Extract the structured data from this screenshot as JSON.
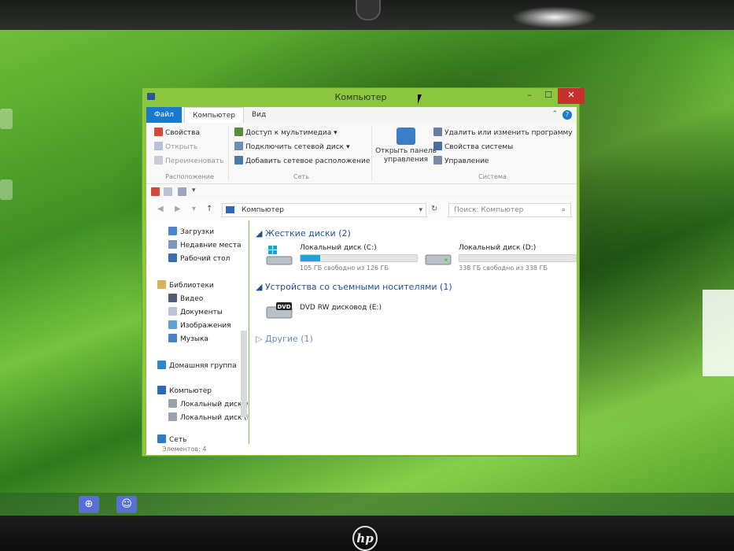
{
  "window": {
    "title": "Компьютер",
    "controls": {
      "minimize": "–",
      "maximize": "☐",
      "close": "✕"
    }
  },
  "ribbon": {
    "tabs": [
      "Файл",
      "Компьютер",
      "Вид"
    ],
    "location": {
      "label": "Расположение",
      "items": [
        "Свойства",
        "Открыть",
        "Переименовать"
      ]
    },
    "network": {
      "label": "Сеть",
      "items": [
        "Доступ к мультимедиа",
        "Подключить сетевой диск",
        "Добавить сетевое расположение"
      ]
    },
    "control_panel": {
      "line1": "Открыть панель",
      "line2": "управления"
    },
    "system": {
      "label": "Система",
      "items": [
        "Удалить или изменить программу",
        "Свойства системы",
        "Управление"
      ]
    }
  },
  "address": {
    "path": "Компьютер",
    "search_placeholder": "Поиск: Компьютер"
  },
  "nav_pane": {
    "items": [
      "Загрузки",
      "Недавние места",
      "Рабочий стол",
      "Библиотеки",
      "Видео",
      "Документы",
      "Изображения",
      "Музыка",
      "Домашняя группа",
      "Компьютер",
      "Локальный диск (C:)",
      "Локальный диск (D:)",
      "Сеть"
    ]
  },
  "content": {
    "hard_drives_header": "Жесткие диски (2)",
    "drives": [
      {
        "name": "Локальный диск (C:)",
        "free": "105 ГБ свободно из 126 ГБ",
        "used_fraction": 0.17
      },
      {
        "name": "Локальный диск (D:)",
        "free": "338 ГБ свободно из 338 ГБ",
        "used_fraction": 0.0
      }
    ],
    "removable_header": "Устройства со съемными носителями (1)",
    "dvd": {
      "name": "DVD RW дисковод (E:)",
      "badge": "DVD"
    },
    "other_header": "Другие (1)"
  },
  "status": {
    "items_count": "Элементов: 4"
  },
  "bezel": {
    "brand": "hp"
  },
  "colors": {
    "window_border": "#8cc63f",
    "file_tab": "#1979ca",
    "close_button": "#c7302c",
    "drive_fill": "#26a0da",
    "group_header": "#1f4e9b"
  }
}
